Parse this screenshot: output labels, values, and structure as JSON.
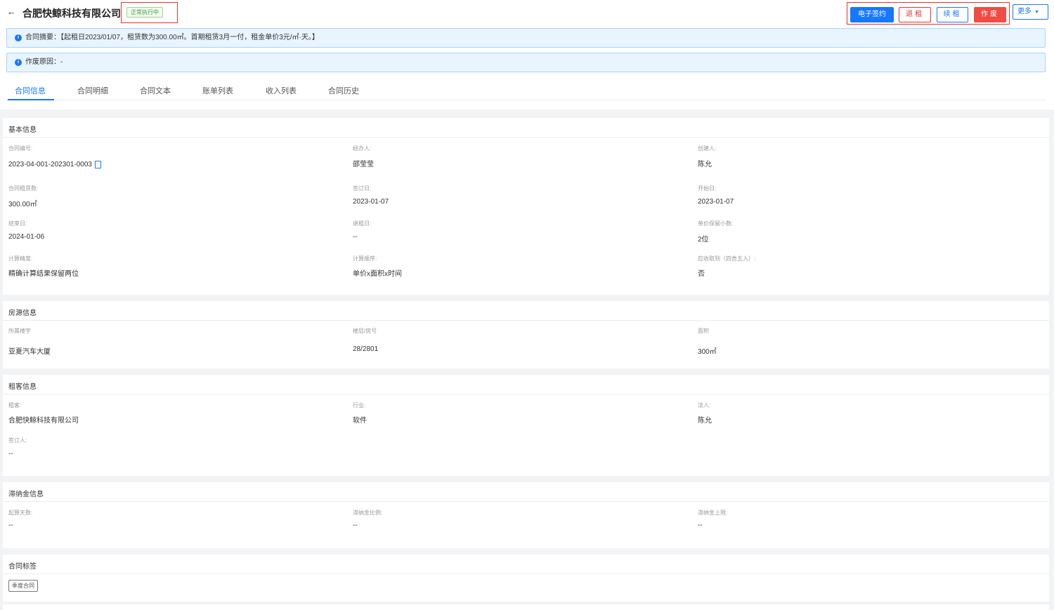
{
  "header": {
    "title": "合肥快鲸科技有限公司",
    "status": "正常执行中",
    "actions": {
      "esign": "电子签约",
      "return": "退租",
      "renew": "续租",
      "void": "作废",
      "more": "更多"
    }
  },
  "alerts": {
    "summary": "合同摘要：【起租日2023/01/07，租赁数为300.00㎡。首期租赁3月一付，租金单价3元/㎡·天。】",
    "void_reason": "作废原因：-"
  },
  "tabs": [
    "合同信息",
    "合同明细",
    "合同文本",
    "账单列表",
    "收入列表",
    "合同历史"
  ],
  "basic_info": {
    "title": "基本信息",
    "fields": [
      {
        "label": "合同编号:",
        "value": "2023-04-001-202301-0003"
      },
      {
        "label": "经办人:",
        "value": "邵莹莹"
      },
      {
        "label": "创建人:",
        "value": "陈允"
      },
      {
        "label": "合同租赁数:",
        "value": "300.00㎡"
      },
      {
        "label": "签订日:",
        "value": "2023-01-07"
      },
      {
        "label": "开始日:",
        "value": "2023-01-07"
      },
      {
        "label": "结束日:",
        "value": "2024-01-06"
      },
      {
        "label": "退租日:",
        "value": "--"
      },
      {
        "label": "单价保留小数:",
        "value": "2位"
      },
      {
        "label": "计算精度:",
        "value": "精确计算结果保留两位"
      },
      {
        "label": "计算顺序:",
        "value": "单价x面积x时间"
      },
      {
        "label": "应收取到（四舍五入）:",
        "value": "否"
      }
    ]
  },
  "property_info": {
    "title": "房源信息",
    "fields": [
      {
        "label": "所属楼宇",
        "value": "亚夏汽车大厦"
      },
      {
        "label": "楼层/房号",
        "value": "28/2801"
      },
      {
        "label": "面积",
        "value": "300㎡"
      }
    ]
  },
  "tenant_info": {
    "title": "租客信息",
    "fields": [
      {
        "label": "租客:",
        "value": "合肥快鲸科技有限公司"
      },
      {
        "label": "行业:",
        "value": "软件"
      },
      {
        "label": "法人:",
        "value": "陈允"
      },
      {
        "label": "签订人:",
        "value": "--"
      }
    ]
  },
  "late_fee_info": {
    "title": "滞纳金信息",
    "fields": [
      {
        "label": "起算天数:",
        "value": "--"
      },
      {
        "label": "滞纳金比例:",
        "value": "--"
      },
      {
        "label": "滞纳金上限:",
        "value": "--"
      }
    ]
  },
  "contract_tags": {
    "title": "合同标签",
    "tags": [
      "季度合同"
    ]
  },
  "colors": {
    "primary": "#1677ff",
    "danger": "#f04b44",
    "success": "#3aa33a",
    "alert_bg": "#e8f4ff"
  },
  "icons": {
    "back": "arrow-left-icon",
    "info": "info-circle-icon",
    "copy": "copy-icon",
    "more": "chevron-down-icon"
  }
}
